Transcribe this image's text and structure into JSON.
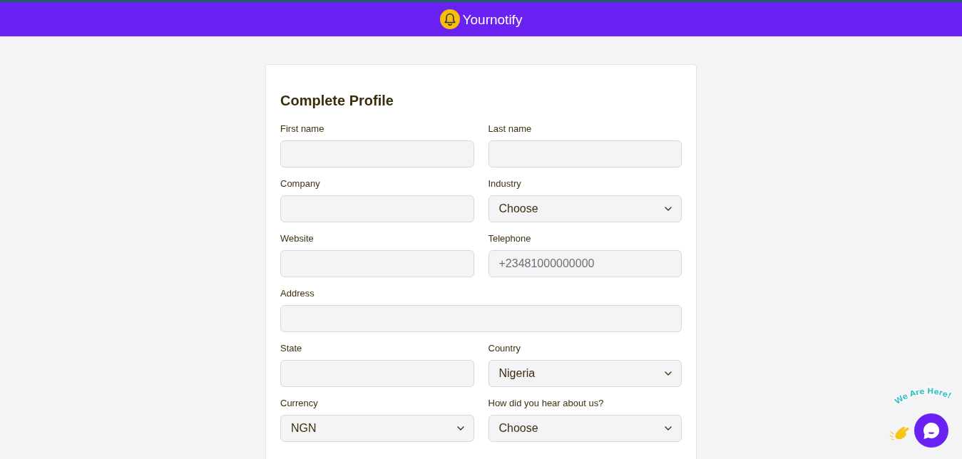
{
  "header": {
    "brand": "Yournotify"
  },
  "form": {
    "title": "Complete Profile",
    "rows": [
      [
        {
          "label": "First name",
          "kind": "text"
        },
        {
          "label": "Last name",
          "kind": "text"
        }
      ],
      [
        {
          "label": "Company",
          "kind": "text"
        },
        {
          "label": "Industry",
          "kind": "select",
          "value": "Choose"
        }
      ],
      [
        {
          "label": "Website",
          "kind": "text"
        },
        {
          "label": "Telephone",
          "kind": "text",
          "placeholder": "+23481000000000"
        }
      ],
      [
        {
          "label": "Address",
          "kind": "text"
        }
      ],
      [
        {
          "label": "State",
          "kind": "text"
        },
        {
          "label": "Country",
          "kind": "select",
          "value": "Nigeria"
        }
      ],
      [
        {
          "label": "Currency",
          "kind": "select",
          "value": "NGN"
        },
        {
          "label": "How did you hear about us?",
          "kind": "select",
          "value": "Choose"
        }
      ]
    ]
  },
  "chat_widget": {
    "greeting": "We Are Here!"
  }
}
